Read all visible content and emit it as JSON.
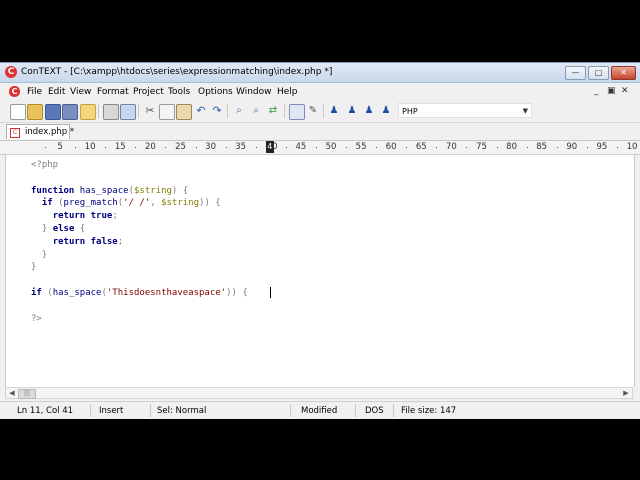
{
  "window": {
    "title": "ConTEXT - [C:\\xampp\\htdocs\\series\\expressionmatching\\index.php *]",
    "app_icon_letter": "C",
    "controls": [
      "—",
      "□",
      "✕"
    ]
  },
  "menu": {
    "items": [
      "File",
      "Edit",
      "View",
      "Format",
      "Project",
      "Tools",
      "Options",
      "Window",
      "Help"
    ],
    "mdi_controls": [
      "_",
      "▣",
      "✕"
    ]
  },
  "toolbar": {
    "language": "PHP",
    "buttons": [
      "new-file-icon",
      "open-file-icon",
      "save-icon",
      "save-all-icon",
      "open-folder-icon",
      "print-icon",
      "print-preview-icon",
      "cut-icon",
      "copy-icon",
      "paste-icon",
      "undo-icon",
      "redo-icon",
      "find-icon",
      "find-next-icon",
      "replace-icon",
      "export-icon",
      "tools-icon",
      "user-tool-1-icon",
      "user-tool-2-icon",
      "user-tool-3-icon",
      "user-tool-4-icon"
    ]
  },
  "tabs": [
    {
      "label": "index.php *"
    }
  ],
  "ruler": {
    "labels": [
      "5",
      "10",
      "15",
      "20",
      "25",
      "30",
      "35",
      "40",
      "45",
      "50",
      "55",
      "60",
      "65",
      "70",
      "75",
      "80",
      "85",
      "90",
      "95",
      "10"
    ],
    "current_column_marker": "4"
  },
  "editor": {
    "lines": [
      "<?php",
      "",
      "function has_space($string) {",
      "  if (preg_match('/ /', $string)) {",
      "    return true;",
      "  } else {",
      "    return false;",
      "  }",
      "}",
      "",
      "if (has_space('Thisdoesnthaveaspace')) {",
      "",
      "?>"
    ]
  },
  "status": {
    "position": "Ln 11, Col 41",
    "mode": "Insert",
    "selection": "Sel: Normal",
    "modified": "Modified",
    "line_endings": "DOS",
    "file_size": "File size: 147"
  },
  "colors": {
    "keyword": "#000080",
    "variable": "#808000",
    "string": "#800000",
    "punctuation": "#808080",
    "php_tag": "#808080"
  }
}
